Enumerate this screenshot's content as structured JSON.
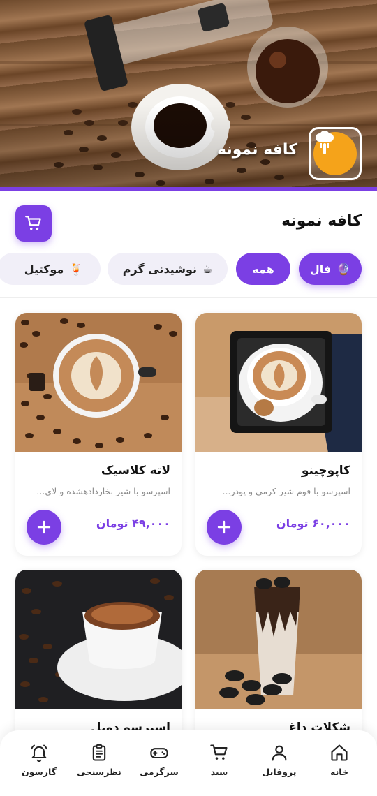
{
  "hero": {
    "cafe_name": "کافه نمونه"
  },
  "header": {
    "title": "کافه نمونه"
  },
  "categories": [
    {
      "label": "فال",
      "emoji": "🔮",
      "active": true
    },
    {
      "label": "همه",
      "emoji": "",
      "active": true
    },
    {
      "label": "نوشیدنی گرم",
      "emoji": "☕",
      "active": false
    },
    {
      "label": "موکتیل",
      "emoji": "🍹",
      "active": false
    }
  ],
  "products": [
    {
      "name": "کاپوچینو",
      "description": "اسپرسو با فوم شیر کرمی و پودر...",
      "price": "۶۰,۰۰۰ تومان"
    },
    {
      "name": "لاته کلاسیک",
      "description": "اسپرسو با شیر بخاردادهشده و لای...",
      "price": "۴۹,۰۰۰ تومان"
    },
    {
      "name": "شکلات داغ",
      "description": "",
      "price": ""
    },
    {
      "name": "اسپرسو دوبل",
      "description": "",
      "price": ""
    }
  ],
  "nav": [
    {
      "label": "خانه",
      "icon": "home-icon"
    },
    {
      "label": "پروفایل",
      "icon": "user-icon"
    },
    {
      "label": "سبد",
      "icon": "cart-icon"
    },
    {
      "label": "سرگرمی",
      "icon": "gamepad-icon"
    },
    {
      "label": "نظرسنجی",
      "icon": "clipboard-icon"
    },
    {
      "label": "گارسون",
      "icon": "bell-icon"
    }
  ],
  "colors": {
    "accent": "#7b3fe4",
    "logo": "#f5a31a"
  }
}
